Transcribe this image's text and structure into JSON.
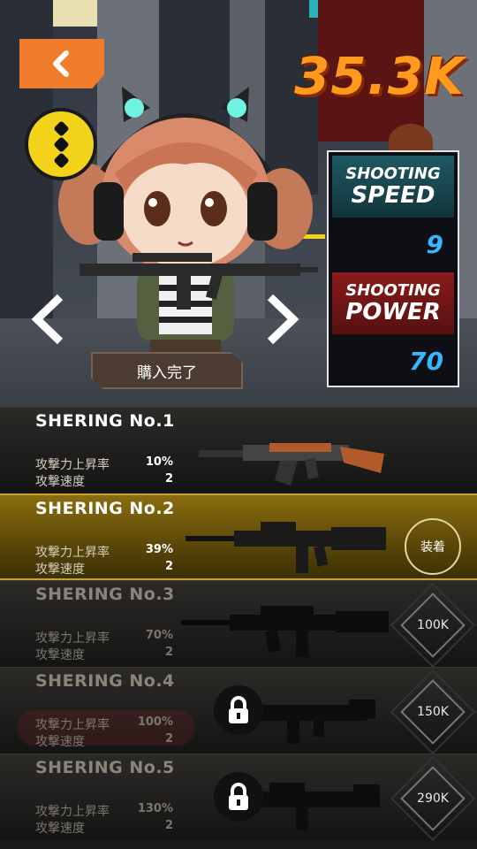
{
  "header": {
    "score": "35.3K",
    "back_icon": "chevron-left-icon",
    "menu_icon": "vertical-dots-icon"
  },
  "stats": {
    "speed": {
      "line1": "SHOOTING",
      "line2": "SPEED",
      "value": "9"
    },
    "power": {
      "line1": "SHOOTING",
      "line2": "POWER",
      "value": "70"
    }
  },
  "character": {
    "status": "購入完了"
  },
  "weapons": [
    {
      "name": "SHERING No.1",
      "attack_label": "攻撃力上昇率",
      "attack": "10%",
      "speed_label": "攻撃速度",
      "speed": "2",
      "state": "owned"
    },
    {
      "name": "SHERING No.2",
      "attack_label": "攻撃力上昇率",
      "attack": "39%",
      "speed_label": "攻撃速度",
      "speed": "2",
      "state": "selected",
      "action": "装着"
    },
    {
      "name": "SHERING No.3",
      "attack_label": "攻撃力上昇率",
      "attack": "70%",
      "speed_label": "攻撃速度",
      "speed": "2",
      "state": "locked",
      "price": "100K"
    },
    {
      "name": "SHERING No.4",
      "attack_label": "攻撃力上昇率",
      "attack": "100%",
      "speed_label": "攻撃速度",
      "speed": "2",
      "state": "locked",
      "price": "150K"
    },
    {
      "name": "SHERING No.5",
      "attack_label": "攻撃力上昇率",
      "attack": "130%",
      "speed_label": "攻撃速度",
      "speed": "2",
      "state": "locked",
      "price": "290K"
    }
  ],
  "colors": {
    "score": "#ff9a1e",
    "back_button": "#f07d2c",
    "menu_button": "#f2d31a",
    "stat_value": "#38b6ff",
    "speed_header": "#1f5964",
    "power_header": "#8a1b1b",
    "selected_row": "#8a6d10"
  }
}
